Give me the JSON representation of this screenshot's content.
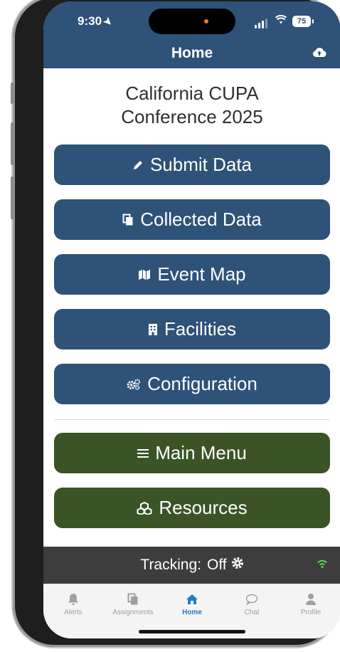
{
  "status_bar": {
    "time": "9:30",
    "battery": "75"
  },
  "header": {
    "title": "Home",
    "sync_icon": "cloud-upload-icon"
  },
  "conference": {
    "line1": "California CUPA",
    "line2": "Conference 2025"
  },
  "menu": {
    "submit_data": "Submit Data",
    "collected_data": "Collected Data",
    "event_map": "Event Map",
    "facilities": "Facilities",
    "configuration": "Configuration",
    "main_menu": "Main Menu",
    "resources": "Resources"
  },
  "tracking": {
    "label": "Tracking:",
    "value": "Off"
  },
  "tabs": [
    {
      "label": "Alerts",
      "icon": "bell-icon"
    },
    {
      "label": "Assignments",
      "icon": "documents-icon"
    },
    {
      "label": "Home",
      "icon": "home-icon",
      "active": true
    },
    {
      "label": "Chat",
      "icon": "chat-icon"
    },
    {
      "label": "Profile",
      "icon": "person-icon"
    }
  ],
  "colors": {
    "primary": "#2e5278",
    "secondary": "#3b5426",
    "tracking_bg": "#3d3d3d",
    "active_tab": "#2a78c8",
    "wifi_on": "#5cd64c"
  }
}
